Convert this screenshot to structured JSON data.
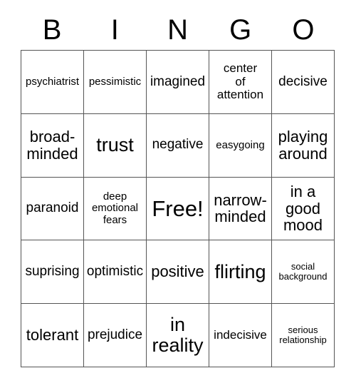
{
  "title": "BINGO Card",
  "header": {
    "letters": [
      "B",
      "I",
      "N",
      "G",
      "O"
    ]
  },
  "grid": {
    "columns": 5,
    "rows": 5,
    "border_color": "#555555",
    "background_color": "#ffffff",
    "text_color": "#000000",
    "cells": [
      {
        "text": "psychiatrist",
        "size": "sm"
      },
      {
        "text": "pessimistic",
        "size": "sm"
      },
      {
        "text": "imagined",
        "size": "lg"
      },
      {
        "text": "center\nof\nattention",
        "size": "md"
      },
      {
        "text": "decisive",
        "size": "lg"
      },
      {
        "text": "broad-\nminded",
        "size": "xl"
      },
      {
        "text": "trust",
        "size": "xxl"
      },
      {
        "text": "negative",
        "size": "lg"
      },
      {
        "text": "easygoing",
        "size": "sm"
      },
      {
        "text": "playing\naround",
        "size": "xl"
      },
      {
        "text": "paranoid",
        "size": "lg"
      },
      {
        "text": "deep\nemotional\nfears",
        "size": "sm"
      },
      {
        "text": "Free!",
        "size": "free"
      },
      {
        "text": "narrow-\nminded",
        "size": "xl"
      },
      {
        "text": "in a\ngood\nmood",
        "size": "xl"
      },
      {
        "text": "suprising",
        "size": "lg"
      },
      {
        "text": "optimistic",
        "size": "lg"
      },
      {
        "text": "positive",
        "size": "xl"
      },
      {
        "text": "flirting",
        "size": "xxl"
      },
      {
        "text": "social\nbackground",
        "size": "xs"
      },
      {
        "text": "tolerant",
        "size": "xl"
      },
      {
        "text": "prejudice",
        "size": "lg"
      },
      {
        "text": "in\nreality",
        "size": "xxl"
      },
      {
        "text": "indecisive",
        "size": "md"
      },
      {
        "text": "serious\nrelationship",
        "size": "xs"
      }
    ]
  }
}
